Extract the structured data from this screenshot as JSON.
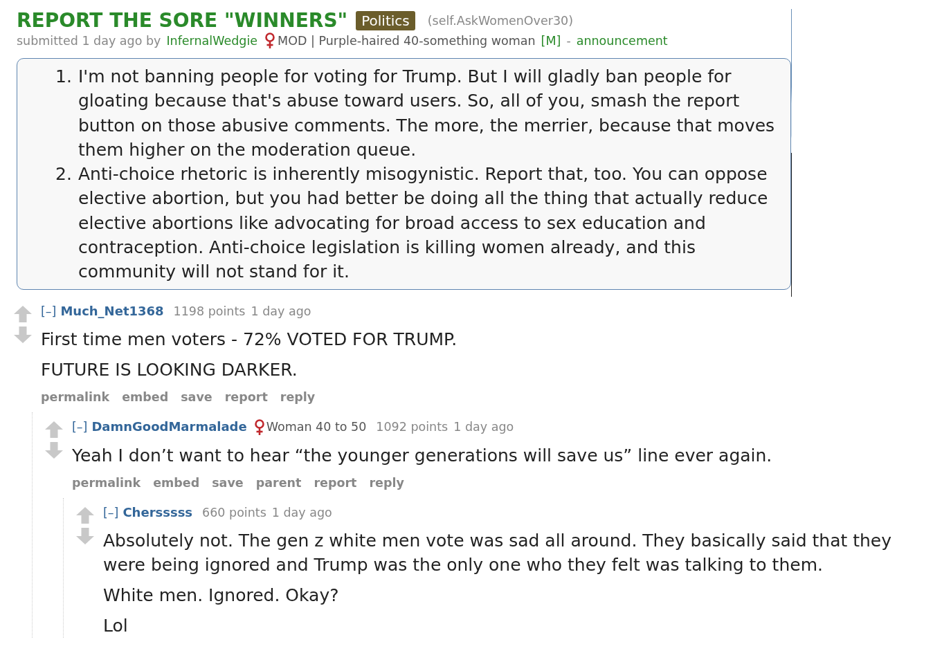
{
  "post": {
    "title": "REPORT THE SORE \"WINNERS\"",
    "flair": "Politics",
    "domain": "(self.AskWomenOver30)",
    "tagline": {
      "submitted": "submitted 1 day ago by",
      "author": "InfernalWedgie",
      "author_flair": "MOD | Purple-haired 40-something woman",
      "mod_tag": "[M]",
      "separator": "-",
      "tag": "announcement"
    },
    "body": [
      {
        "number": "1.",
        "text": "I'm not banning people for voting for Trump. But I will gladly ban people for gloating because that's abuse toward users. So, all of you, smash the report button on those abusive comments. The more, the merrier, because that moves them higher on the moderation queue."
      },
      {
        "number": "2.",
        "text": "Anti-choice rhetoric is inherently misogynistic. Report that, too. You can oppose elective abortion, but you had better be doing all the thing that actually reduce elective abortions like advocating for broad access to sex education and contraception. Anti-choice legislation is killing women already, and this community will not stand for it."
      }
    ]
  },
  "comments": [
    {
      "collapse": "[–]",
      "author": "Much_Net1368",
      "score": "1198 points",
      "time": "1 day ago",
      "body": [
        "First time men voters - 72% VOTED FOR TRUMP.",
        "FUTURE IS LOOKING DARKER."
      ],
      "actions": [
        "permalink",
        "embed",
        "save",
        "report",
        "reply"
      ],
      "children": [
        {
          "collapse": "[–]",
          "author": "DamnGoodMarmalade",
          "flair": "Woman 40 to 50",
          "score": "1092 points",
          "time": "1 day ago",
          "body": [
            "Yeah I don’t want to hear “the younger generations will save us” line ever again."
          ],
          "actions": [
            "permalink",
            "embed",
            "save",
            "parent",
            "report",
            "reply"
          ],
          "children": [
            {
              "collapse": "[–]",
              "author": "Chersssss",
              "score": "660 points",
              "time": "1 day ago",
              "body": [
                "Absolutely not. The gen z white men vote was sad all around. They basically said that they were being ignored and Trump was the only one who they felt was talking to them.",
                "White men. Ignored. Okay?",
                "Lol"
              ]
            }
          ]
        }
      ]
    }
  ]
}
